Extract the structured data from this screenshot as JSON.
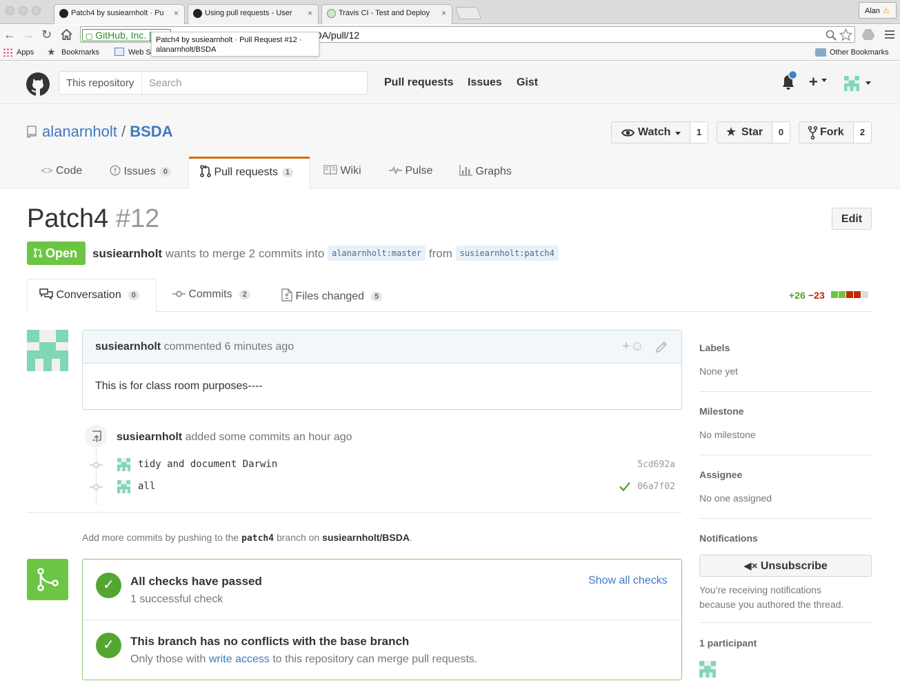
{
  "browser": {
    "tabs": [
      {
        "title": "Patch4 by susiearnholt · Pu",
        "close": "×"
      },
      {
        "title": "Using pull requests - User",
        "close": "×"
      },
      {
        "title": "Travis CI - Test and Deploy",
        "close": "×"
      }
    ],
    "user": "Alan",
    "omnibox": {
      "ev_label": "GitHub, Inc. [US]",
      "url": "https://github.com/alanarnholt/BSDA/pull/12"
    },
    "tooltip": {
      "line1": "Patch4 by susiearnholt · Pull Request #12 ·",
      "line2": "alanarnholt/BSDA"
    },
    "bookmarks": {
      "apps": "Apps",
      "bookmarks": "Bookmarks",
      "web": "Web S",
      "other": "Other Bookmarks"
    }
  },
  "header": {
    "scope": "This repository",
    "search_placeholder": "Search",
    "nav": [
      "Pull requests",
      "Issues",
      "Gist"
    ]
  },
  "repo": {
    "owner": "alanarnholt",
    "sep": "/",
    "name": "BSDA",
    "watch": {
      "label": "Watch",
      "count": "1"
    },
    "star": {
      "label": "Star",
      "count": "0"
    },
    "fork": {
      "label": "Fork",
      "count": "2"
    },
    "tabs": {
      "code": "Code",
      "issues": "Issues",
      "issues_count": "0",
      "pulls": "Pull requests",
      "pulls_count": "1",
      "wiki": "Wiki",
      "pulse": "Pulse",
      "graphs": "Graphs"
    }
  },
  "pr": {
    "title": "Patch4",
    "number": "#12",
    "edit": "Edit",
    "state": "Open",
    "author": "susiearnholt",
    "merge_text": "wants to merge 2 commits into",
    "base": "alanarnholt:master",
    "from": "from",
    "head": "susiearnholt:patch4",
    "subnav": {
      "conversation": "Conversation",
      "conversation_count": "0",
      "commits": "Commits",
      "commits_count": "2",
      "files": "Files changed",
      "files_count": "5"
    },
    "additions": "+26",
    "deletions": "−23"
  },
  "timeline": {
    "comment_author": "susiearnholt",
    "comment_meta": "commented 6 minutes ago",
    "comment_body": "This is for class room purposes----",
    "commits_author": "susiearnholt",
    "commits_meta": "added some commits an hour ago",
    "commits": [
      {
        "message": "tidy and document Darwin",
        "sha": "5cd692a"
      },
      {
        "message": "all",
        "sha": "06a7f02"
      }
    ],
    "push_hint": {
      "pre": "Add more commits by pushing to the",
      "branch": "patch4",
      "mid": "branch on",
      "repo": "susiearnholt/BSDA",
      "end": "."
    }
  },
  "merge": {
    "checks_title": "All checks have passed",
    "checks_sub": "1 successful check",
    "show_all": "Show all checks",
    "conflict_title": "This branch has no conflicts with the base branch",
    "conflict_pre": "Only those with",
    "conflict_link": "write access",
    "conflict_post": "to this repository can merge pull requests."
  },
  "sidebar": {
    "labels": {
      "title": "Labels",
      "value": "None yet"
    },
    "milestone": {
      "title": "Milestone",
      "value": "No milestone"
    },
    "assignee": {
      "title": "Assignee",
      "value": "No one assigned"
    },
    "notifications": {
      "title": "Notifications",
      "button": "Unsubscribe",
      "note1": "You’re receiving notifications",
      "note2": "because you authored the thread."
    },
    "participants": "1 participant"
  },
  "colors": {
    "open_green": "#6cc644",
    "link_blue": "#4078c0",
    "tab_orange": "#d26911",
    "check_green": "#55a532"
  }
}
